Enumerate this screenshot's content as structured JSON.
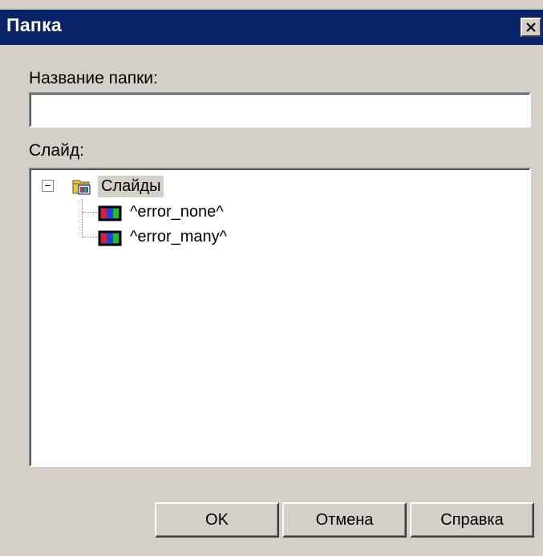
{
  "window": {
    "title": "Папка",
    "title_bar_color": "#0a246a",
    "background_color": "#d4d0c8"
  },
  "form": {
    "folder_name_label": "Название папки:",
    "folder_name_value": "",
    "slide_label": "Слайд:"
  },
  "tree": {
    "root": {
      "label": "Слайды",
      "expanded": true,
      "selected": true,
      "icon": "folder-icon"
    },
    "items": [
      {
        "label": "^error_none^",
        "icon": "slide-icon"
      },
      {
        "label": "^error_many^",
        "icon": "slide-icon"
      }
    ]
  },
  "buttons": {
    "ok": "OK",
    "cancel": "Отмена",
    "help": "Справка"
  }
}
